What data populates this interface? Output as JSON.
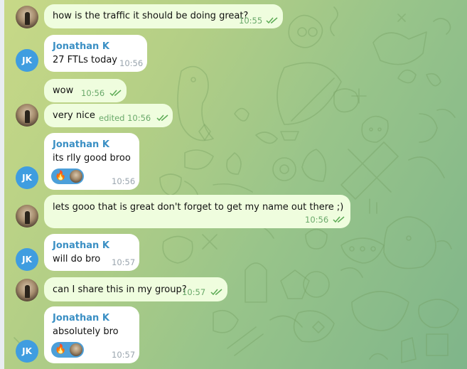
{
  "colors": {
    "outgoing_bubble": "#effdde",
    "incoming_bubble": "#ffffff",
    "sender_name": "#3a8fc4",
    "jk_avatar": "#3f9de0",
    "reaction_bg": "#4c9fd9"
  },
  "contact": {
    "initials": "JK",
    "name": "Jonathan K"
  },
  "messages": [
    {
      "direction": "out",
      "text": "how is the traffic it should be doing great?",
      "time": "10:55",
      "status": "read-check-icon"
    },
    {
      "direction": "in",
      "sender": "Jonathan K",
      "text": "27 FTLs today",
      "time": "10:56"
    },
    {
      "direction": "out",
      "text": "wow",
      "time": "10:56",
      "status": "read-check-icon"
    },
    {
      "direction": "out",
      "text": "very nice",
      "time": "edited 10:56",
      "status": "read-check-icon"
    },
    {
      "direction": "in",
      "sender": "Jonathan K",
      "text": "its rlly good broo",
      "time": "10:56",
      "reaction": "🔥"
    },
    {
      "direction": "out",
      "text": "lets gooo that is great don't forget to get my name out there ;)",
      "time": "10:56",
      "status": "read-check-icon"
    },
    {
      "direction": "in",
      "sender": "Jonathan K",
      "text": "will do bro",
      "time": "10:57"
    },
    {
      "direction": "out",
      "text": "can I share this in my group?",
      "time": "10:57",
      "status": "read-check-icon"
    },
    {
      "direction": "in",
      "sender": "Jonathan K",
      "text": "absolutely bro",
      "time": "10:57",
      "reaction": "🔥"
    }
  ]
}
